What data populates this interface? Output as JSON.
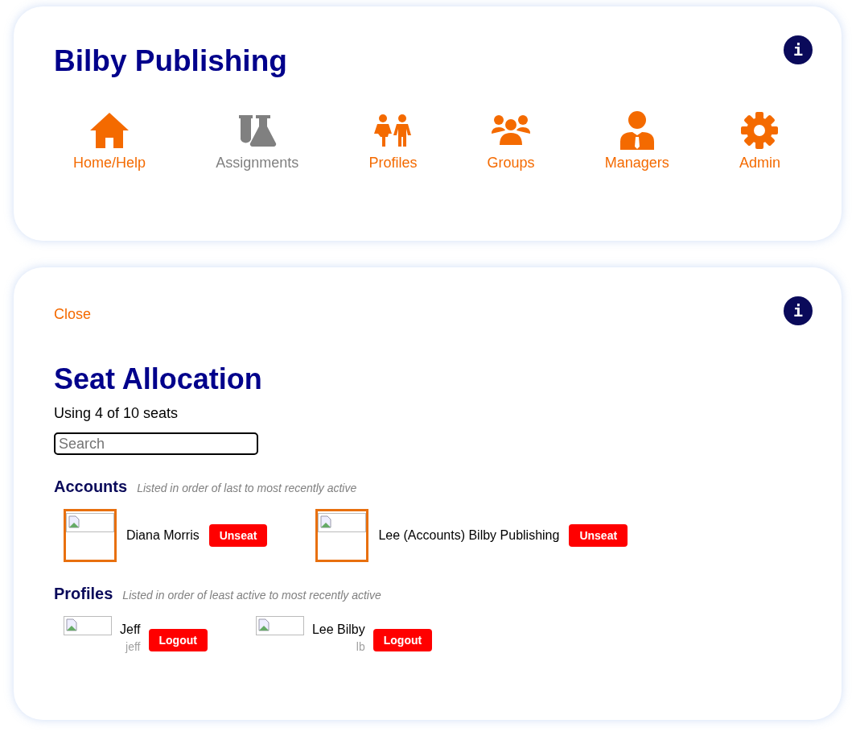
{
  "header": {
    "title": "Bilby Publishing",
    "info_button": "i"
  },
  "nav": [
    {
      "kind": "home",
      "label": "Home/Help",
      "disabled": false
    },
    {
      "kind": "flasks",
      "label": "Assignments",
      "disabled": true
    },
    {
      "kind": "children",
      "label": "Profiles",
      "disabled": false
    },
    {
      "kind": "group",
      "label": "Groups",
      "disabled": false
    },
    {
      "kind": "manager",
      "label": "Managers",
      "disabled": false
    },
    {
      "kind": "gear",
      "label": "Admin",
      "disabled": false
    }
  ],
  "panel": {
    "close": "Close",
    "info_button": "i",
    "title": "Seat Allocation",
    "usage": "Using 4 of 10 seats",
    "search": {
      "placeholder": "Search"
    },
    "accounts": {
      "heading": "Accounts",
      "note": "Listed in order of last to most recently active",
      "items": [
        {
          "name": "Diana Morris",
          "action": "Unseat"
        },
        {
          "name": "Lee (Accounts) Bilby Publishing",
          "action": "Unseat"
        }
      ]
    },
    "profiles": {
      "heading": "Profiles",
      "note": "Listed in order of least active to most recently active",
      "items": [
        {
          "name": "Jeff",
          "username": "jeff",
          "action": "Logout"
        },
        {
          "name": "Lee Bilby",
          "username": "lb",
          "action": "Logout"
        }
      ]
    }
  }
}
